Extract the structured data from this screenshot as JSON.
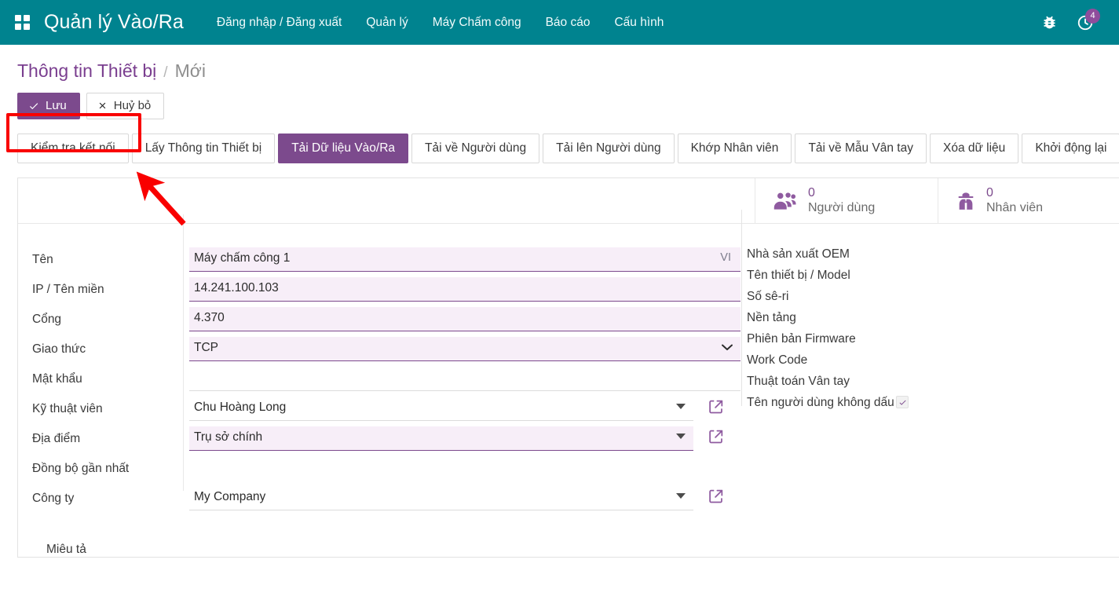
{
  "navbar": {
    "apps_icon": "apps-grid-icon",
    "brand": "Quản lý Vào/Ra",
    "menu": [
      {
        "label": "Đăng nhập / Đăng xuất"
      },
      {
        "label": "Quản lý"
      },
      {
        "label": "Máy Chấm công"
      },
      {
        "label": "Báo cáo"
      },
      {
        "label": "Cấu hình"
      }
    ],
    "bug_icon": "bug-icon",
    "timer_icon": "timer-icon",
    "timer_badge": "4",
    "bg_color": "#00838f",
    "badge_color": "#8f4d9c"
  },
  "breadcrumb": {
    "root": "Thông tin Thiết bị",
    "separator": "/",
    "current": "Mới"
  },
  "actions": {
    "save_label": "Lưu",
    "save_icon": "check-icon",
    "discard_label": "Huỷ bỏ",
    "discard_icon": "close-icon",
    "primary_color": "#7c4a8d"
  },
  "button_bar": {
    "buttons": [
      {
        "label": "Kiểm tra kết nối",
        "active": false,
        "highlighted": true
      },
      {
        "label": "Lấy Thông tin Thiết bị",
        "active": false
      },
      {
        "label": "Tải Dữ liệu Vào/Ra",
        "active": true
      },
      {
        "label": "Tải về Người dùng",
        "active": false
      },
      {
        "label": "Tải lên Người dùng",
        "active": false
      },
      {
        "label": "Khớp Nhân viên",
        "active": false
      },
      {
        "label": "Tải về Mẫu Vân tay",
        "active": false
      },
      {
        "label": "Xóa dữ liệu",
        "active": false
      },
      {
        "label": "Khởi động lại",
        "active": false
      }
    ]
  },
  "annotation": {
    "box_color": "#f90000",
    "arrow_color": "#f90000"
  },
  "stats": [
    {
      "value": "0",
      "label": "Người dùng",
      "icon": "users-icon"
    },
    {
      "value": "0",
      "label": "Nhân viên",
      "icon": "employee-icon"
    }
  ],
  "form": {
    "left_fields": [
      {
        "label": "Tên",
        "value": "Máy chấm công 1",
        "lang": "VI",
        "kind": "text-filled"
      },
      {
        "label": "IP / Tên miền",
        "value": "14.241.100.103",
        "kind": "text-filled"
      },
      {
        "label": "Cổng",
        "value": "4.370",
        "kind": "text-filled"
      },
      {
        "label": "Giao thức",
        "value": "TCP",
        "kind": "select"
      },
      {
        "label": "Mật khẩu",
        "value": "",
        "kind": "text-empty"
      },
      {
        "label": "Kỹ thuật viên",
        "value": "Chu Hoàng Long",
        "kind": "many2one-plain",
        "ext_link": true
      },
      {
        "label": "Địa điểm",
        "value": "Trụ sở chính",
        "kind": "many2one-filled",
        "ext_link": true
      },
      {
        "label": "Đồng bộ gần nhất",
        "value": "",
        "kind": "blank"
      },
      {
        "label": "Công ty",
        "value": "My Company",
        "kind": "many2one-plain",
        "ext_link": true
      }
    ],
    "right_fields": [
      {
        "label": "Nhà sản xuất OEM",
        "value": ""
      },
      {
        "label": "Tên thiết bị / Model",
        "value": ""
      },
      {
        "label": "Số sê-ri",
        "value": ""
      },
      {
        "label": "Nền tảng",
        "value": ""
      },
      {
        "label": "Phiên bản Firmware",
        "value": ""
      },
      {
        "label": "Work Code",
        "value": ""
      },
      {
        "label": "Thuật toán Vân tay",
        "value": ""
      },
      {
        "label": "Tên người dùng không dấu",
        "value": "",
        "kind": "checkbox",
        "checked": true
      }
    ],
    "description_label": "Miêu tả"
  }
}
